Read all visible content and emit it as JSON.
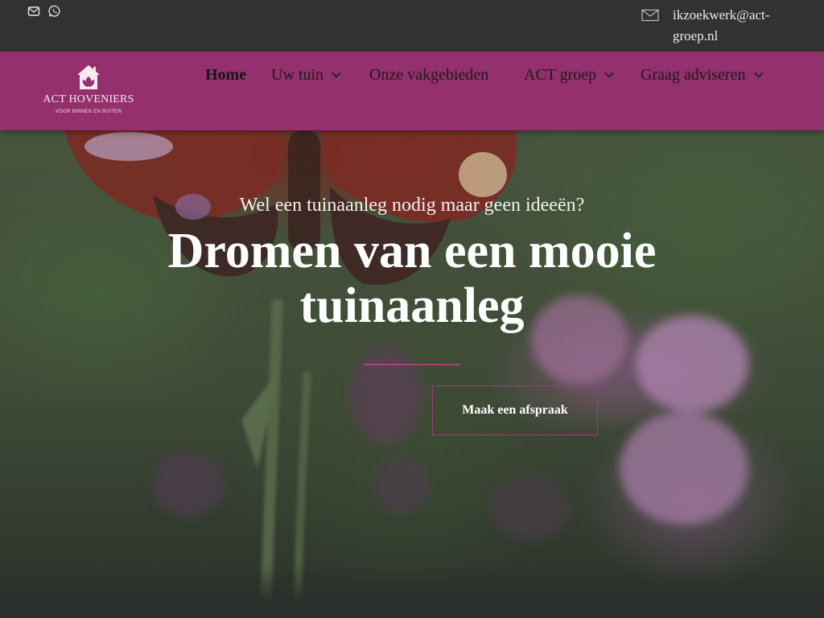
{
  "topbar": {
    "email": "ikzoekwerk@act-groep.nl",
    "icons": [
      "mail-icon",
      "whatsapp-icon",
      "envelope-icon"
    ]
  },
  "logo": {
    "name": "ACT HOVENIERS",
    "tagline": "VOOR BINNEN EN BUITEN"
  },
  "nav": {
    "items": [
      {
        "label": "Home",
        "active": true,
        "has_dropdown": false
      },
      {
        "label": "Uw tuin",
        "has_dropdown": true
      },
      {
        "label": "Onze vakgebieden",
        "has_dropdown": false
      },
      {
        "label": "ACT groep",
        "has_dropdown": true
      },
      {
        "label": "Graag adviseren",
        "has_dropdown": true
      }
    ]
  },
  "hero": {
    "subtitle": "Wel een tuinaanleg nodig maar geen ideeën?",
    "title": "Dromen van een mooie tuinaanleg",
    "cta_label": "Maak een afspraak"
  },
  "colors": {
    "topbar": "#323232",
    "navbar": "#93306d",
    "accent": "#a6407f",
    "text_light": "#ffffff"
  }
}
